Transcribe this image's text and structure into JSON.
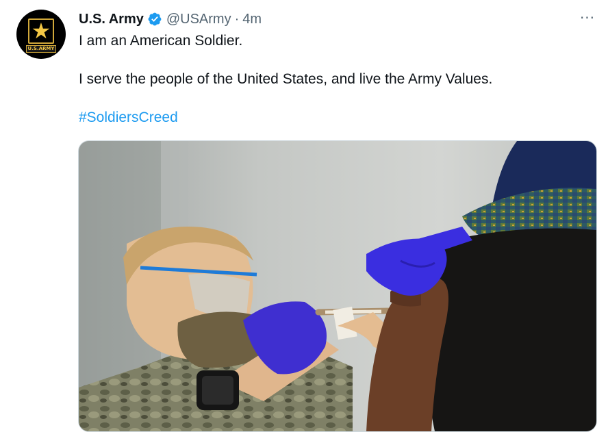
{
  "tweet": {
    "author": {
      "name": "U.S. Army",
      "handle": "@USArmy",
      "verified": true,
      "avatar_icon": "army-star-logo-icon",
      "avatar_badge_text": "U.S.ARMY"
    },
    "separator": "·",
    "time": "4m",
    "more_icon": "more-options-icon",
    "lines": [
      "I am an American Soldier.",
      "I serve the people of the United States, and live the Army Values."
    ],
    "hashtag": "#SoldiersCreed",
    "media": {
      "kind": "photo",
      "subject": "vaccination"
    }
  },
  "colors": {
    "text": "#0f1419",
    "secondary": "#536471",
    "link": "#1d9bf0",
    "verified": "#1d9bf0",
    "avatar_gold": "#f3c745"
  }
}
